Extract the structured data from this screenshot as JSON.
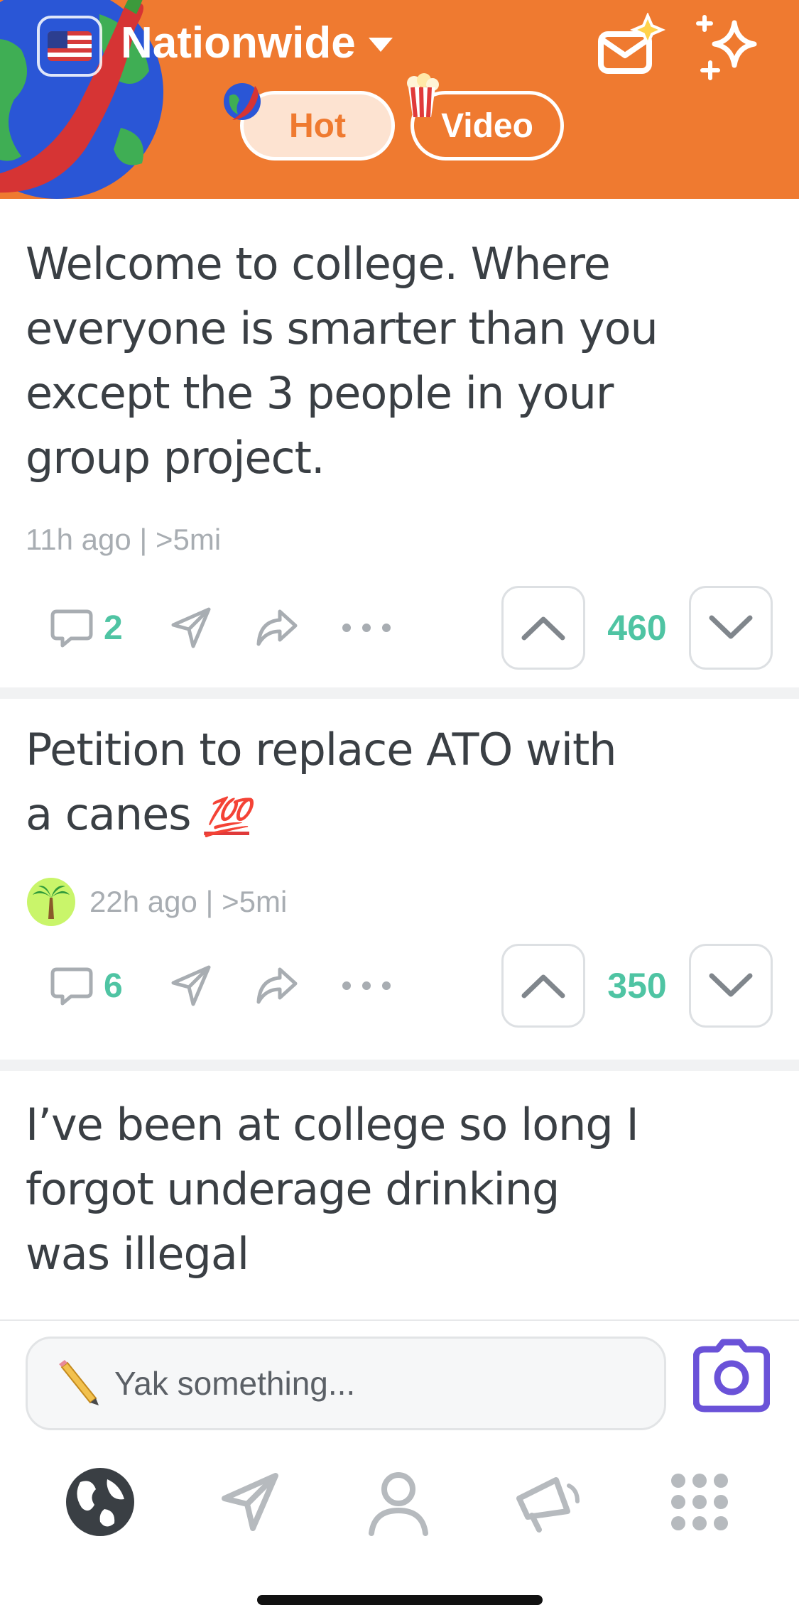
{
  "colors": {
    "brand_orange": "#ef7a30",
    "accent_green": "#4fc4a3",
    "camera_purple": "#6a52d8"
  },
  "header": {
    "location": "Nationwide",
    "flag_icon": "us-flag-icon",
    "tabs": [
      {
        "label": "Hot",
        "active": true,
        "emoji": "globe-pepper-emoji"
      },
      {
        "label": "Video",
        "active": false,
        "emoji": "popcorn-emoji"
      }
    ]
  },
  "posts": [
    {
      "text": "Welcome to college. Where everyone is smarter than you except the 3 people in your group project.",
      "meta": "11h ago | >5mi",
      "comments": "2",
      "score": "460"
    },
    {
      "text": "Petition to replace ATO with a canes",
      "emoji": "💯",
      "meta": "22h ago | >5mi",
      "comments": "6",
      "score": "350"
    },
    {
      "text": "I’ve been at college so long I forgot underage drinking was illegal"
    }
  ],
  "composer": {
    "placeholder": "Yak something..."
  },
  "nav": [
    "feed-globe-icon",
    "messages-icon",
    "profile-icon",
    "announcements-icon",
    "more-grid-icon"
  ]
}
